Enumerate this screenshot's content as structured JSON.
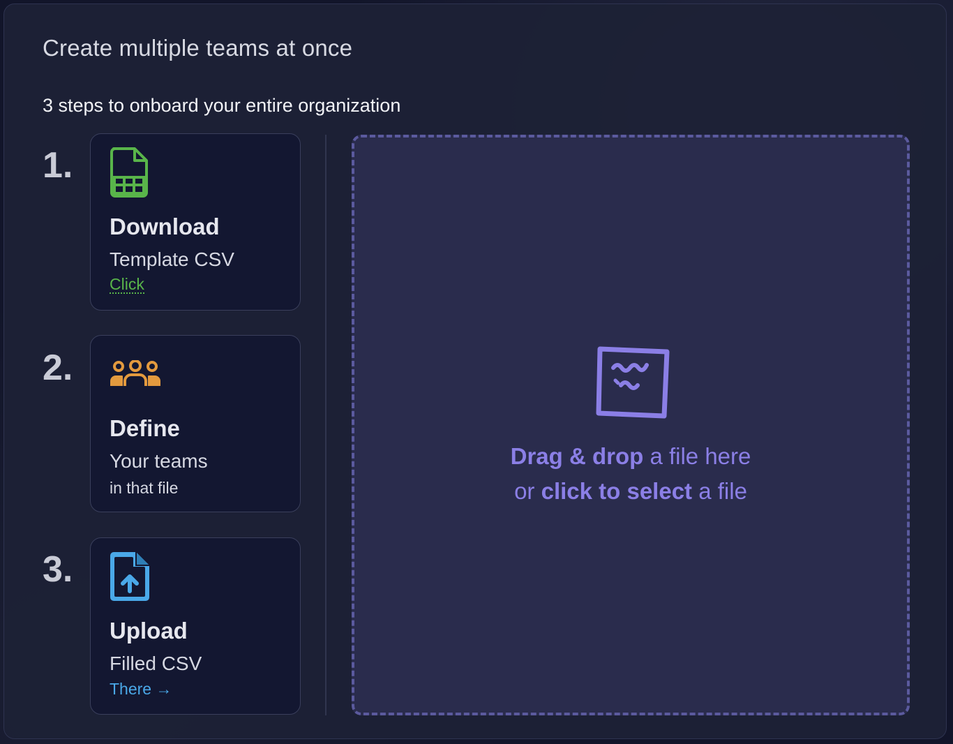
{
  "modal": {
    "title": "Create multiple teams at once",
    "subtitle": "3 steps to onboard your entire organization"
  },
  "steps": [
    {
      "number": "1.",
      "icon": "spreadsheet-file-icon",
      "title": "Download",
      "subtitle": "Template CSV",
      "link": "Click",
      "link_color": "#59b54a"
    },
    {
      "number": "2.",
      "icon": "team-group-icon",
      "title": "Define",
      "subtitle": "Your teams",
      "note": "in that file"
    },
    {
      "number": "3.",
      "icon": "file-upload-icon",
      "title": "Upload",
      "subtitle": "Filled CSV",
      "link": "There →",
      "link_color": "#4aa8e8"
    }
  ],
  "dropzone": {
    "icon": "file-squiggle-icon",
    "line1_strong": "Drag & drop",
    "line1_rest": " a file here",
    "line2_lead": "or ",
    "line2_strong": "click to select",
    "line2_rest": " a file",
    "accent_color": "#8b7fe6"
  }
}
